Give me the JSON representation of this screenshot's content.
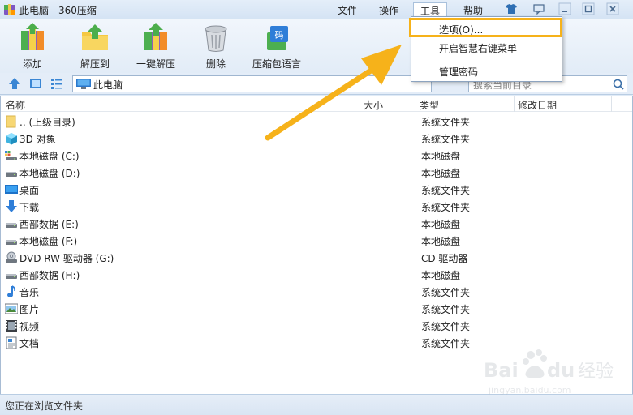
{
  "window": {
    "title": "此电脑 - 360压缩",
    "menus": [
      "文件",
      "操作",
      "工具",
      "帮助"
    ]
  },
  "toolbar": {
    "buttons": [
      {
        "label": "添加",
        "icon": "add-archive-icon"
      },
      {
        "label": "解压到",
        "icon": "extract-to-icon"
      },
      {
        "label": "一键解压",
        "icon": "one-click-extract-icon"
      },
      {
        "label": "删除",
        "icon": "trash-icon"
      },
      {
        "label": "压缩包语言",
        "icon": "archive-language-icon"
      }
    ]
  },
  "address": {
    "path": "此电脑",
    "search_placeholder": "搜索当前目录"
  },
  "columns": [
    "名称",
    "大小",
    "类型",
    "修改日期"
  ],
  "rows": [
    {
      "name": ".. (上级目录)",
      "type": "系统文件夹",
      "icon": "parent-folder-icon"
    },
    {
      "name": "3D 对象",
      "type": "系统文件夹",
      "icon": "3d-objects-icon"
    },
    {
      "name": "本地磁盘 (C:)",
      "type": "本地磁盘",
      "icon": "system-drive-icon"
    },
    {
      "name": "本地磁盘 (D:)",
      "type": "本地磁盘",
      "icon": "drive-icon"
    },
    {
      "name": "桌面",
      "type": "系统文件夹",
      "icon": "desktop-icon"
    },
    {
      "name": "下载",
      "type": "系统文件夹",
      "icon": "download-icon"
    },
    {
      "name": "西部数据 (E:)",
      "type": "本地磁盘",
      "icon": "drive-icon"
    },
    {
      "name": "本地磁盘 (F:)",
      "type": "本地磁盘",
      "icon": "drive-icon"
    },
    {
      "name": "DVD RW 驱动器 (G:)",
      "type": "CD 驱动器",
      "icon": "dvd-drive-icon"
    },
    {
      "name": "西部数据 (H:)",
      "type": "本地磁盘",
      "icon": "drive-icon"
    },
    {
      "name": "音乐",
      "type": "系统文件夹",
      "icon": "music-icon"
    },
    {
      "name": "图片",
      "type": "系统文件夹",
      "icon": "pictures-icon"
    },
    {
      "name": "视频",
      "type": "系统文件夹",
      "icon": "videos-icon"
    },
    {
      "name": "文档",
      "type": "系统文件夹",
      "icon": "documents-icon"
    }
  ],
  "dropdown": {
    "items": [
      "选项(O)...",
      "开启智慧右键菜单",
      "管理密码"
    ]
  },
  "status": "您正在浏览文件夹",
  "colors": {
    "highlight": "#f6b21a",
    "arrow": "#f6b21a"
  }
}
